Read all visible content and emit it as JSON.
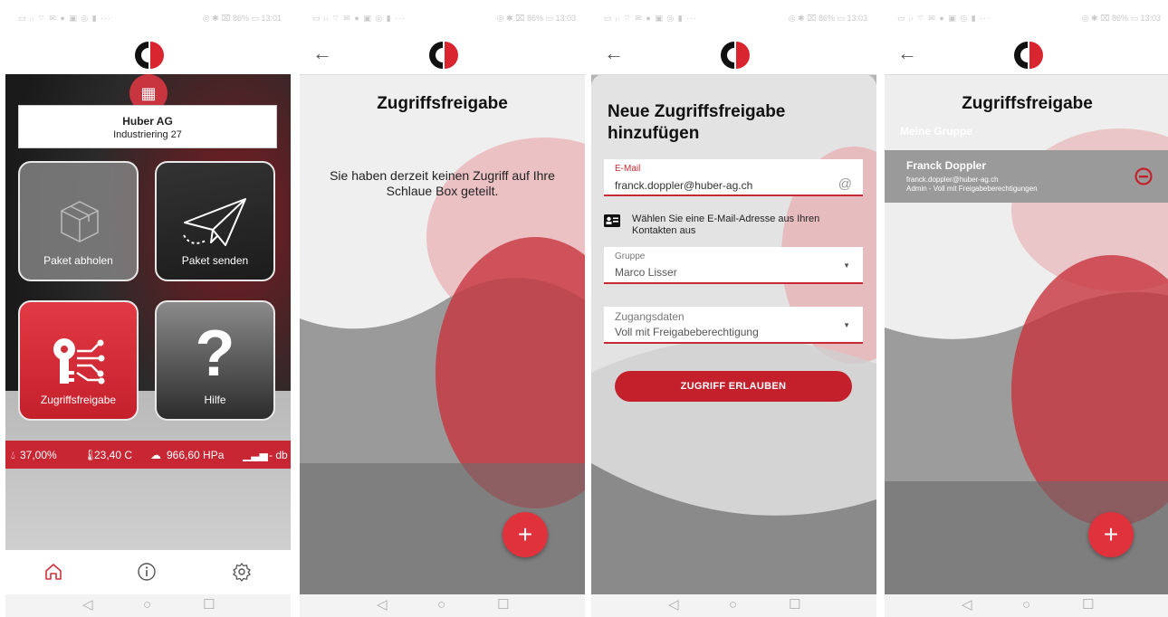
{
  "statusbar": {
    "left_icons": "▭ ᵢₗ ⌔ ✉ ● ▣ ◎ ▮ ···",
    "right": "◎ ✱ ⌧ 86% ▭ 13:01",
    "right_alt": "◎ ✱ ⌧ 86% ▭ 13:03"
  },
  "colors": {
    "brand_red": "#c4202c",
    "fab_red": "#e0323c"
  },
  "screen1": {
    "address_name": "Huber AG",
    "address_street": "Industriering 27",
    "tiles": [
      {
        "label": "Paket abholen",
        "icon": "package-box-icon"
      },
      {
        "label": "Paket senden",
        "icon": "paper-plane-icon"
      },
      {
        "label": "Zugriffsfreigabe",
        "icon": "key-network-icon"
      },
      {
        "label": "Hilfe",
        "icon": "question-mark-icon"
      }
    ],
    "sensors": {
      "humidity": "37,00%",
      "temperature": "23,40 C",
      "pressure": "966,60 HPa",
      "signal": "- db"
    },
    "bottom_nav": [
      "home-icon",
      "info-icon",
      "settings-gear-icon"
    ]
  },
  "screen2": {
    "title": "Zugriffsfreigabe",
    "empty_text": "Sie haben derzeit keinen Zugriff auf Ihre Schlaue Box geteilt.",
    "fab": "+"
  },
  "screen3": {
    "title": "Neue Zugriffsfreigabe hinzufügen",
    "email_label": "E-Mail",
    "email_value": "franck.doppler@huber-ag.ch",
    "email_icon": "@",
    "contact_text": "Wählen Sie eine E-Mail-Adresse aus Ihren Kontakten aus",
    "group_label": "Gruppe",
    "group_value": "Marco Lisser",
    "access_label": "Zugangsdaten",
    "access_value": "Voll mit Freigabeberechtigung",
    "submit_label": "ZUGRIFF ERLAUBEN"
  },
  "screen4": {
    "title": "Zugriffsfreigabe",
    "group_label": "Meine Gruppe",
    "member": {
      "name": "Franck Doppler",
      "email": "franck.doppler@huber-ag.ch",
      "role": "Admin - Voll mit Freigabeberechtigungen"
    },
    "fab": "+"
  },
  "android_nav": {
    "back": "◁",
    "home": "○",
    "recent": "☐"
  }
}
